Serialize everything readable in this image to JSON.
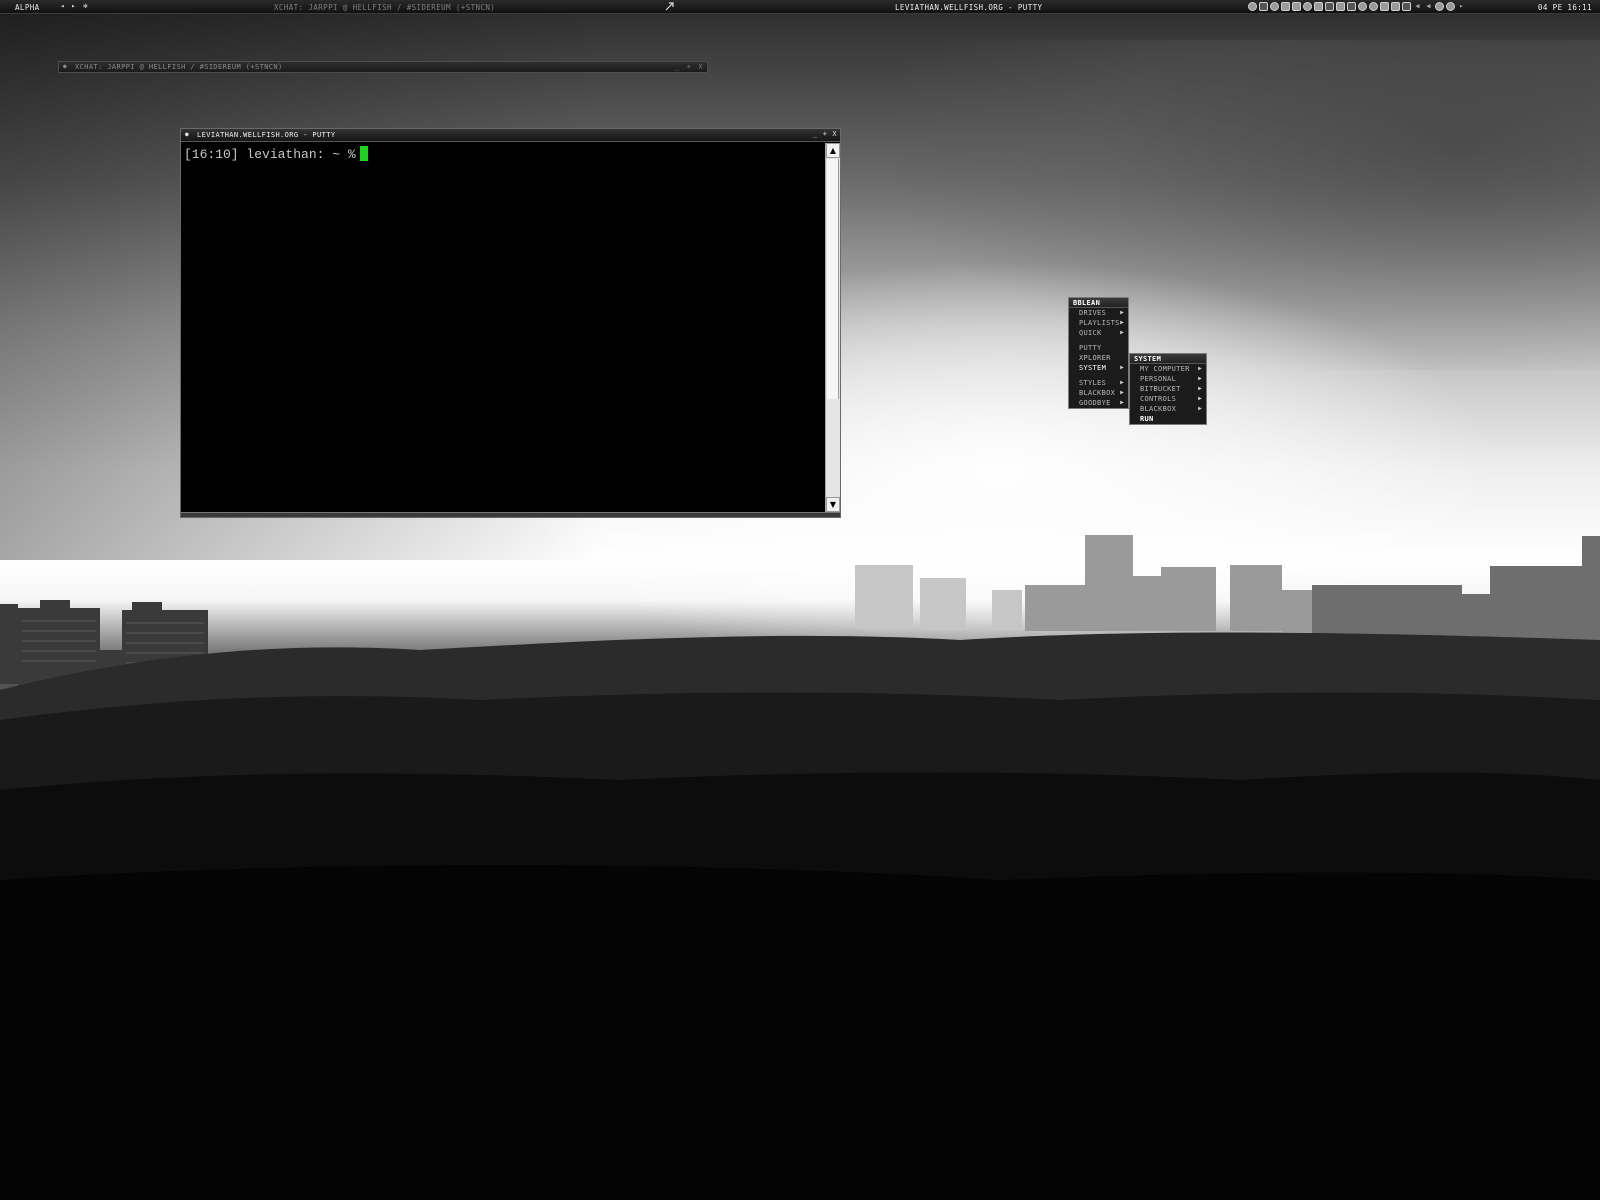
{
  "toolbar": {
    "workspace": "Alpha",
    "prev_icon": "◂",
    "next_icon": "▸",
    "settings_icon": "✻",
    "inactive_task": "XChat: Jarppi @ HellFish / #sidereum (+stnCN)",
    "active_task": "leviathan.wellfish.org - PuTTY",
    "clock": "04 PE 16:11",
    "tray_icons": [
      "network-icon",
      "power-icon",
      "chat-icon",
      "window-icon",
      "shield-icon",
      "antivirus-icon",
      "user-icon",
      "volume-icon",
      "usb-icon",
      "display-icon",
      "search-icon",
      "globe-icon",
      "copy-icon",
      "monitor-icon",
      "tools-icon",
      "back-arrow-icon",
      "play-icon",
      "dropper-icon",
      "refresh-icon",
      "next-arrow-icon"
    ]
  },
  "xchat_window": {
    "icon": "●",
    "title": "XChat: Jarppi @ HellFish / #sidereum (+stnCN)",
    "minimize": "_",
    "maximize": "+",
    "close": "x"
  },
  "putty": {
    "icon": "●",
    "title": "leviathan.wellfish.org - PuTTY",
    "minimize": "_",
    "maximize": "+",
    "close": "x",
    "prompt": "[16:10] leviathan: ~ %",
    "cursor_color": "#1fd21f",
    "scroll_up": "▲",
    "scroll_down": "▼"
  },
  "menu": {
    "title": "bbLean",
    "items": [
      {
        "label": "Drives",
        "submenu": true
      },
      {
        "label": "Playlists",
        "submenu": true
      },
      {
        "label": "Quick",
        "submenu": true
      },
      {
        "label": "PuTTY",
        "submenu": false
      },
      {
        "label": "xplorer",
        "submenu": false
      },
      {
        "label": "System",
        "submenu": true,
        "highlighted": true
      },
      {
        "label": "Styles",
        "submenu": true
      },
      {
        "label": "Blackbox",
        "submenu": true
      },
      {
        "label": "Goodbye",
        "submenu": true
      }
    ],
    "submenu_arrow": "▶"
  },
  "submenu": {
    "title": "System",
    "items": [
      {
        "label": "My Computer",
        "submenu": true
      },
      {
        "label": "Personal",
        "submenu": true
      },
      {
        "label": "Bitbucket",
        "submenu": true
      },
      {
        "label": "Controls",
        "submenu": true
      },
      {
        "label": "Blackbox",
        "submenu": true
      },
      {
        "label": "Run",
        "submenu": false
      }
    ]
  }
}
